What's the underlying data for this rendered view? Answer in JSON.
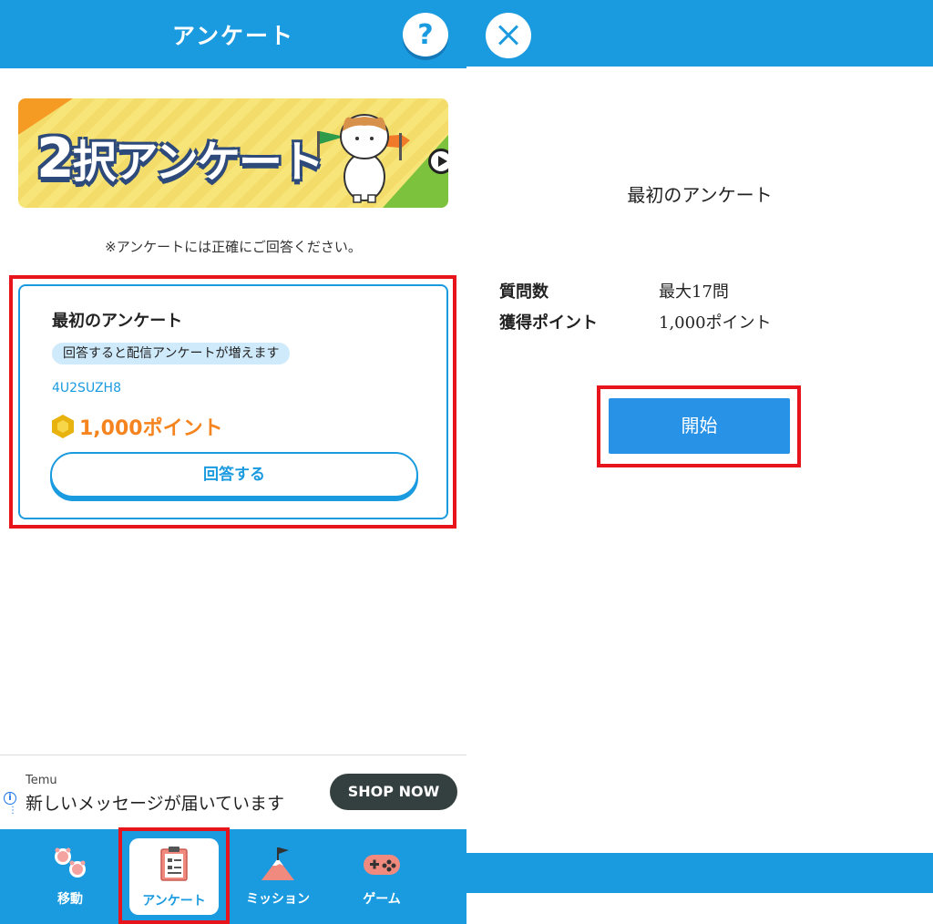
{
  "left": {
    "header": {
      "title": "アンケート",
      "help_label": "?"
    },
    "banner": {
      "num": "2",
      "title": "択アンケート"
    },
    "notice": "※アンケートには正確にご回答ください。",
    "survey_card": {
      "title": "最初のアンケート",
      "tag": "回答すると配信アンケートが増えます",
      "id": "4U2SUZH8",
      "points": "1,000ポイント",
      "answer_button": "回答する"
    },
    "ad": {
      "brand": "Temu",
      "message": "新しいメッセージが届いています",
      "cta": "SHOP NOW",
      "info_icon": "i"
    },
    "nav": [
      {
        "label": "移動",
        "icon": "paw-icon"
      },
      {
        "label": "アンケート",
        "icon": "clipboard-icon"
      },
      {
        "label": "ミッション",
        "icon": "mountain-flag-icon"
      },
      {
        "label": "ゲーム",
        "icon": "gamepad-icon"
      }
    ]
  },
  "right": {
    "title": "最初のアンケート",
    "details": [
      {
        "key": "質問数",
        "value": "最大17問"
      },
      {
        "key": "獲得ポイント",
        "value": "1,000ポイント"
      }
    ],
    "start_button": "開始"
  },
  "colors": {
    "primary": "#1a9be0",
    "highlight": "#e8141b",
    "points": "#f5841f",
    "tag_bg": "#cfeafb"
  }
}
